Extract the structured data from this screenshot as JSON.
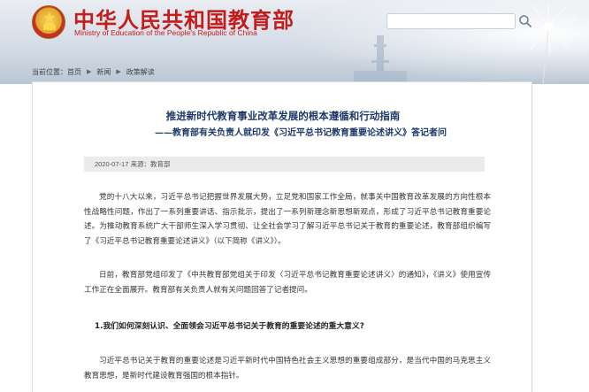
{
  "site": {
    "title": "中华人民共和国教育部",
    "subtitle": "Ministry of Education of the People's Republic of China"
  },
  "search": {
    "placeholder": ""
  },
  "breadcrumb": {
    "label": "当前位置：",
    "items": [
      "首页",
      "新闻",
      "政策解读"
    ]
  },
  "article": {
    "title": "推进新时代教育事业改革发展的根本遵循和行动指南",
    "subtitle": "——教育部有关负责人就印发《习近平总书记教育重要论述讲义》答记者问",
    "meta": "2020-07-17  来源：教育部",
    "paragraphs": [
      "党的十八大以来，习近平总书记把握世界发展大势，立足党和国家工作全局，就事关中国教育改革发展的方向性根本性战略性问题，作出了一系列重要讲话、指示批示，提出了一系列新理念新思想新观点，形成了习近平总书记教育重要论述。为推动教育系统广大干部师生深入学习贯彻、让全社会学习了解习近平总书记关于教育的重要论述，教育部组织编写了《习近平总书记教育重要论述讲义》（以下简称《讲义》）。",
      "日前，教育部党组印发了《中共教育部党组关于印发〈习近平总书记教育重要论述讲义〉的通知》，《讲义》使用宣传工作正在全面展开。教育部有关负责人就有关问题回答了记者提问。",
      "习近平总书记关于教育的重要论述是习近平新时代中国特色社会主义思想的重要组成部分，是当代中国的马克思主义教育思想，是新时代建设教育强国的根本指针。"
    ],
    "question": "1.我们如何深刻认识、全面领会习近平总书记关于教育的重要论述的重大意义?"
  },
  "colors": {
    "brand_red": "#c41b1b",
    "title_blue": "#1f3a6a",
    "meta_bg": "#ebebeb"
  }
}
